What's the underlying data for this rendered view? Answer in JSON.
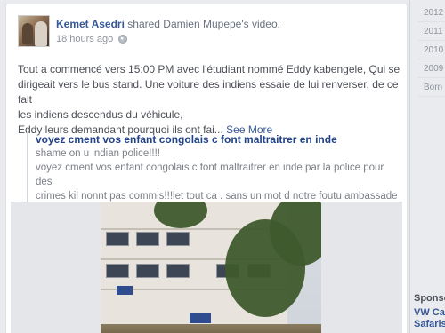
{
  "post": {
    "actor": "Kemet Asedri",
    "action_text": "shared Damien Mupepe's video.",
    "timestamp": "18 hours ago",
    "body_line1": "Tout a commencé vers 15:00 PM avec l'étudiant nommé Eddy kabengele, Qui se",
    "body_line2": "dirigeait vers le bus stand. Une voiture des indiens essaie de lui renverser, de ce fait",
    "body_line3": "les indiens descendus du véhicule,",
    "body_line4": "Eddy leurs demandant pourquoi ils ont fai... ",
    "see_more": "See More",
    "privacy_icon": "globe-icon"
  },
  "shared": {
    "title": "voyez cment vos enfant congolais c font maltraitrer en inde",
    "line1": "shame on u indian police!!!!",
    "line2": "voyez cment vos enfant congolais c font maltraitrer en inde par la police pour des",
    "line3": "crimes kil nonnt pas commis!!!let tout ca . sans un mot d notre foutu ambassade"
  },
  "sidebar": {
    "years": [
      "2012",
      "2011",
      "2010",
      "2009",
      "Born"
    ]
  },
  "ads": {
    "heading": "Sponso",
    "title_line1": "VW Car",
    "title_line2": "Safaris"
  }
}
